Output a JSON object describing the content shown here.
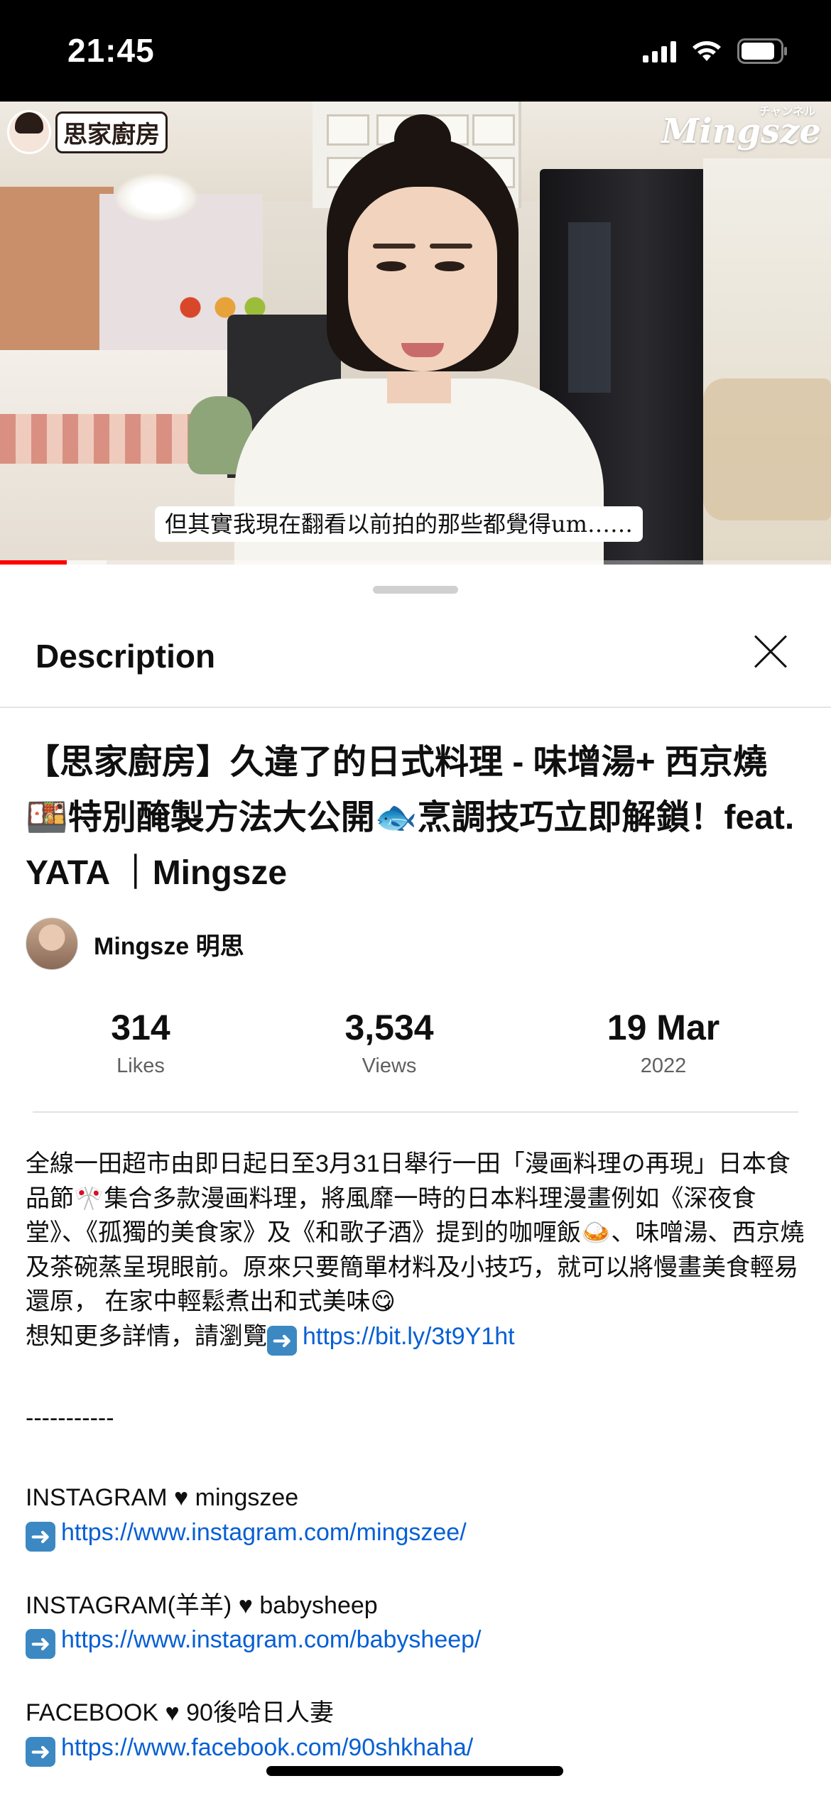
{
  "status_bar": {
    "time": "21:45"
  },
  "video": {
    "channel_logo_text": "思家廚房",
    "brand_watermark": "Mingsze",
    "brand_kana": "チャンネル",
    "subtitle": "但其實我現在翻看以前拍的那些都覺得um……",
    "progress_fraction": 0.08
  },
  "sheet": {
    "title": "Description",
    "video_title": "【思家廚房】久違了的日式料理 - 味增湯+ 西京燒🍱特別醃製方法大公開🐟烹調技巧立即解鎖！feat. YATA ｜Mingsze",
    "channel_name": "Mingsze 明思",
    "stats": [
      {
        "value": "314",
        "label": "Likes"
      },
      {
        "value": "3,534",
        "label": "Views"
      },
      {
        "value": "19 Mar",
        "label": "2022"
      }
    ],
    "description": {
      "para1": "全線一田超市由即日起日至3月31日舉行一田「漫画料理の再現」日本食品節🎌集合多款漫画料理，將風靡一時的日本料理漫畫例如《深夜食堂》、《孤獨的美食家》及《和歌子酒》提到的咖喱飯🍛、味噌湯、西京燒及茶碗蒸呈現眼前。原來只要簡單材料及小技巧，就可以將慢畫美食輕易還原， 在家中輕鬆煮出和式美味😋",
      "more_info_prefix": "想知更多詳情，請瀏覽",
      "more_info_link": "https://bit.ly/3t9Y1ht",
      "separator": "-----------",
      "links": [
        {
          "label": "INSTAGRAM ♥ mingszee",
          "url": "https://www.instagram.com/mingszee/"
        },
        {
          "label": "INSTAGRAM(羊羊) ♥ babysheep",
          "url": "https://www.instagram.com/babysheep/"
        },
        {
          "label": "FACEBOOK ♥ 90後哈日人妻",
          "url": "https://www.facebook.com/90shkhaha/"
        }
      ]
    }
  }
}
